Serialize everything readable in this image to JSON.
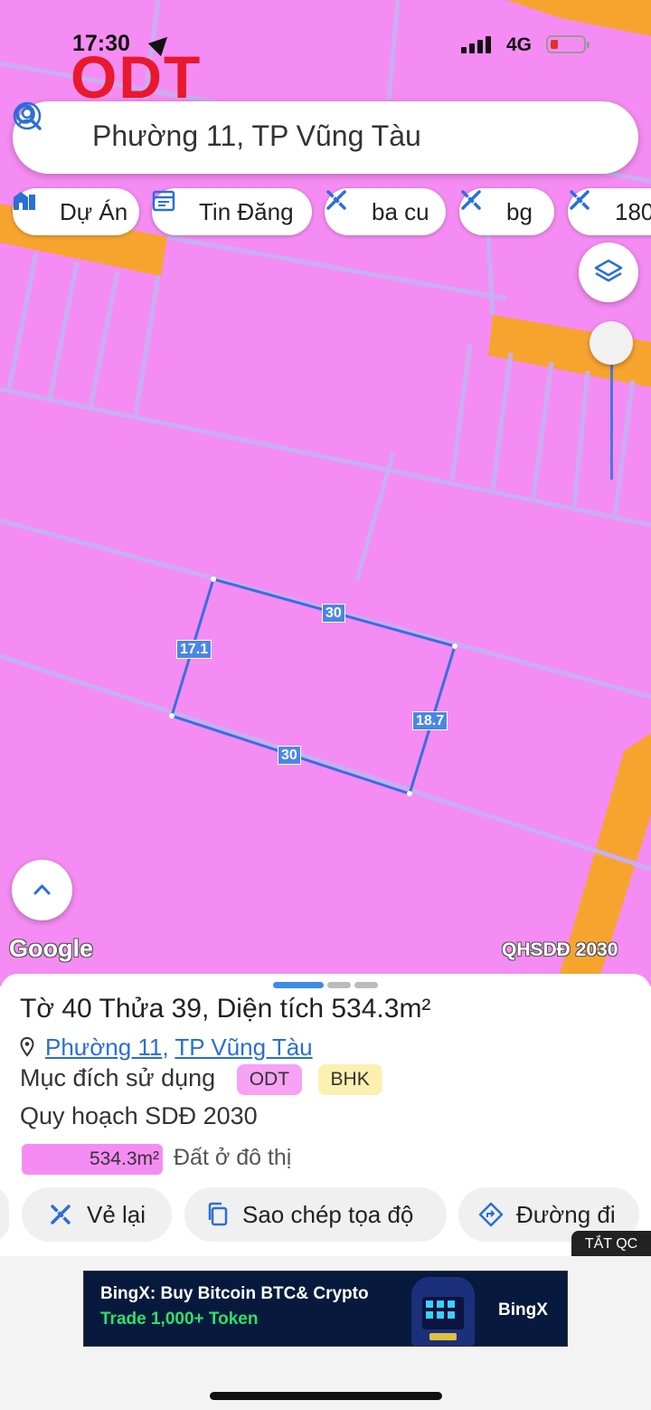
{
  "status_bar": {
    "time": "17:30",
    "network": "4G"
  },
  "map": {
    "zone_code": "ODT",
    "google_label": "Google",
    "layer_label": "QHSDĐ 2030",
    "parcel_dims": {
      "top": "30",
      "left": "17.1",
      "right": "18.7",
      "bottom": "30"
    },
    "colors": {
      "residential": "#f58cf3",
      "road": "#f7a42f",
      "parcel_outline": "#3570e0",
      "boundary": "#c8a8f0"
    }
  },
  "search": {
    "query": "Phường 11, TP Vũng Tàu"
  },
  "chips": [
    {
      "label": "Dự Án",
      "icon": "building-icon"
    },
    {
      "label": "Tin Đăng",
      "icon": "calendar-icon"
    },
    {
      "label": "ba cu",
      "icon": "ruler-pencil-icon"
    },
    {
      "label": "bg",
      "icon": "ruler-pencil-icon"
    },
    {
      "label": "180",
      "icon": "ruler-pencil-icon"
    }
  ],
  "info": {
    "title": "Tờ 40 Thửa 39, Diện tích 534.3m²",
    "ward": "Phường 11",
    "city": "TP Vũng Tàu",
    "purpose_label": "Mục đích sử dụng",
    "purpose_tags": [
      "ODT",
      "BHK"
    ],
    "plan_label": "Quy hoạch SDĐ 2030",
    "plan_area": "534.3m²",
    "plan_type": "Đất ở đô thị",
    "plan_share": 1.0
  },
  "actions": {
    "redraw": "Vẻ lại",
    "copy": "Sao chép tọa độ",
    "directions": "Đường đi"
  },
  "ad": {
    "close_label": "TẮT QC",
    "headline": "BingX: Buy Bitcoin BTC& Crypto",
    "subline": "Trade 1,000+ Token",
    "brand": "BingX"
  }
}
